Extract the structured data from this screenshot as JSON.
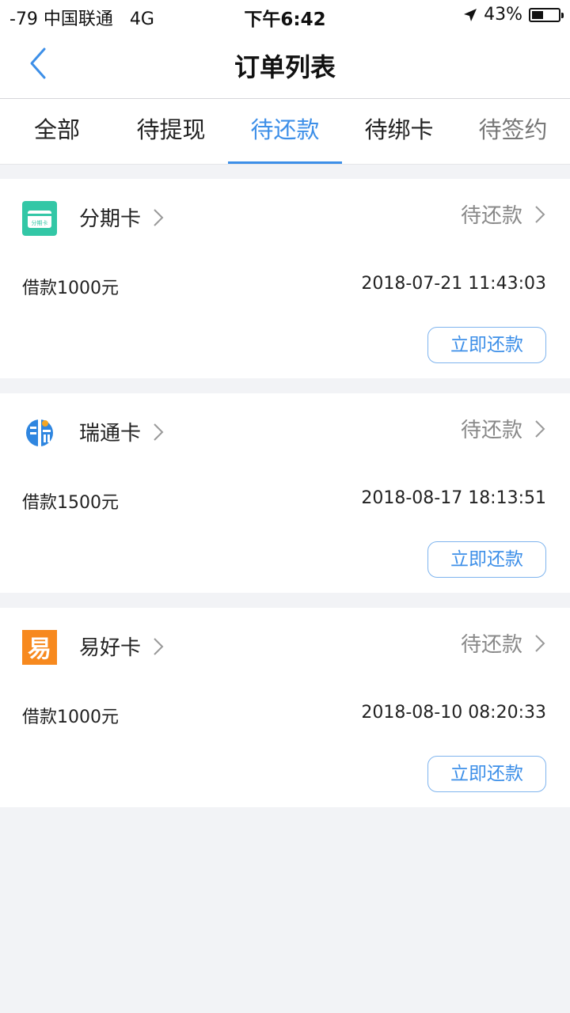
{
  "status_bar": {
    "carrier": "-79 中国联通   4G",
    "time": "下午6:42",
    "battery": "43%",
    "battery_level": 0.43
  },
  "nav": {
    "title": "订单列表",
    "back_icon": "chevron-left-icon"
  },
  "tabs": [
    {
      "label": "全部"
    },
    {
      "label": "待提现"
    },
    {
      "label": "待还款"
    },
    {
      "label": "待绑卡"
    },
    {
      "label": "待签约"
    }
  ],
  "active_tab": 2,
  "colors": {
    "accent": "#3d8fe8",
    "background": "#f2f3f6",
    "logo_fenqi": "#33c7a6",
    "logo_ruitong": "#2f86e0",
    "logo_yihao": "#f7891e"
  },
  "orders": [
    {
      "name": "分期卡",
      "logo_text": "分期卡",
      "status": "待还款",
      "amount": "借款1000元",
      "time": "2018-07-21 11:43:03",
      "action": "立即还款"
    },
    {
      "name": "瑞通卡",
      "logo_text": "",
      "status": "待还款",
      "amount": "借款1500元",
      "time": "2018-08-17 18:13:51",
      "action": "立即还款"
    },
    {
      "name": "易好卡",
      "logo_text": "易",
      "status": "待还款",
      "amount": "借款1000元",
      "time": "2018-08-10 08:20:33",
      "action": "立即还款"
    }
  ]
}
